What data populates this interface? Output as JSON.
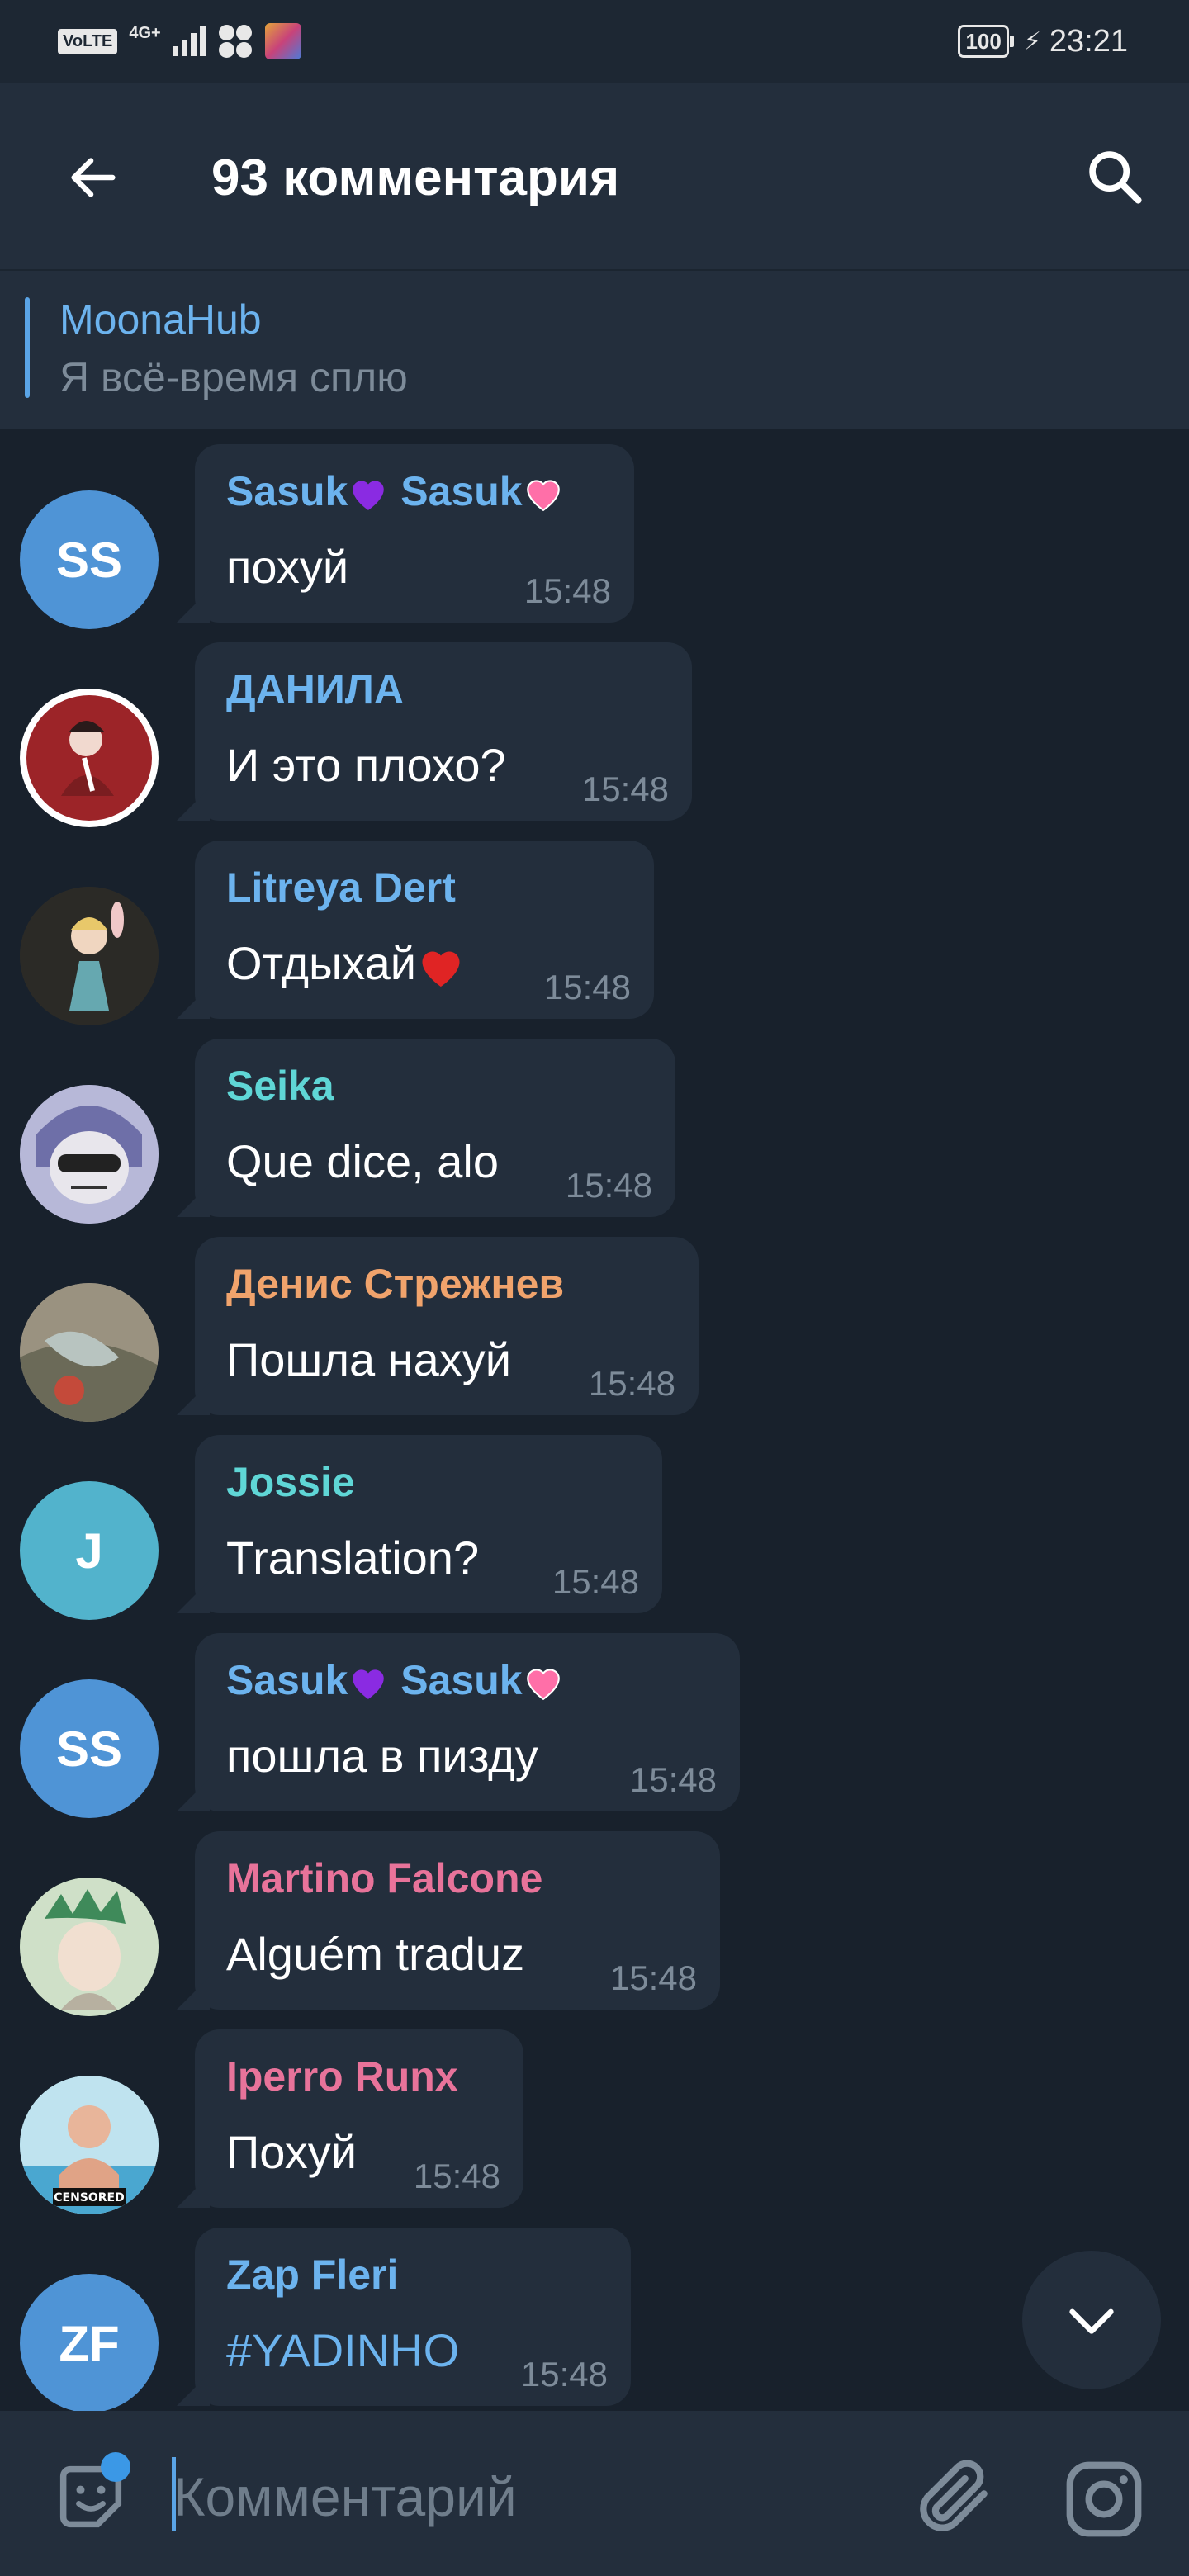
{
  "status_bar": {
    "volte": "VoLTE",
    "network": "4G+",
    "battery": "100",
    "time": "23:21"
  },
  "header": {
    "title": "93 комментария",
    "back_icon": "arrow-left-icon",
    "search_icon": "search-icon"
  },
  "pinned": {
    "name": "MoonaHub",
    "text": "Я всё-время сплю"
  },
  "messages": [
    {
      "avatar_text": "SS",
      "avatar_color": "#4f94d6",
      "sender": "Sasuk",
      "sender2": "Sasuk",
      "name_color": "#6cb3ee",
      "text": "похуй",
      "time": "15:48"
    },
    {
      "avatar_text": "",
      "avatar_color": "#9c2428",
      "sender": "ДАНИЛА",
      "name_color": "#6cb3ee",
      "text": "И это плохо?",
      "time": "15:48"
    },
    {
      "avatar_text": "",
      "avatar_color": "#3a3c38",
      "sender": "Litreya Dert",
      "name_color": "#6cb3ee",
      "text": "Отдыхай",
      "time": "15:48"
    },
    {
      "avatar_text": "",
      "avatar_color": "#8e8fb8",
      "sender": "Seika",
      "name_color": "#5fd6d6",
      "text": "Que dice, alo",
      "time": "15:48"
    },
    {
      "avatar_text": "",
      "avatar_color": "#8b8576",
      "sender": "Денис Стрежнев",
      "name_color": "#f0a36c",
      "text": "Пошла нахуй",
      "time": "15:48"
    },
    {
      "avatar_text": "J",
      "avatar_color": "#52b3cc",
      "sender": "Jossie",
      "name_color": "#5fd6d6",
      "text": "Translation?",
      "time": "15:48"
    },
    {
      "avatar_text": "SS",
      "avatar_color": "#4f94d6",
      "sender": "Sasuk",
      "sender2": "Sasuk",
      "name_color": "#6cb3ee",
      "text": "пошла в пизду",
      "time": "15:48"
    },
    {
      "avatar_text": "",
      "avatar_color": "#7fa878",
      "sender": "Martino Falcone",
      "name_color": "#e8739a",
      "text": "Alguém traduz",
      "time": "15:48"
    },
    {
      "avatar_text": "",
      "avatar_color": "#8fcbe0",
      "avatar_badge": "CENSORED",
      "sender": "Iperro Runx",
      "name_color": "#e8739a",
      "text": "Похуй",
      "time": "15:48"
    },
    {
      "avatar_text": "ZF",
      "avatar_color": "#4f94d6",
      "sender": "Zap Fleri",
      "name_color": "#6cb3ee",
      "text": "#YADINHO",
      "text_color": "#6cb3ee",
      "time": "15:48"
    }
  ],
  "composer": {
    "placeholder": "Комментарий"
  },
  "colors": {
    "background": "#18212c",
    "panel": "#232e3c",
    "accent": "#5aa4e6",
    "muted": "#7d8b99"
  }
}
